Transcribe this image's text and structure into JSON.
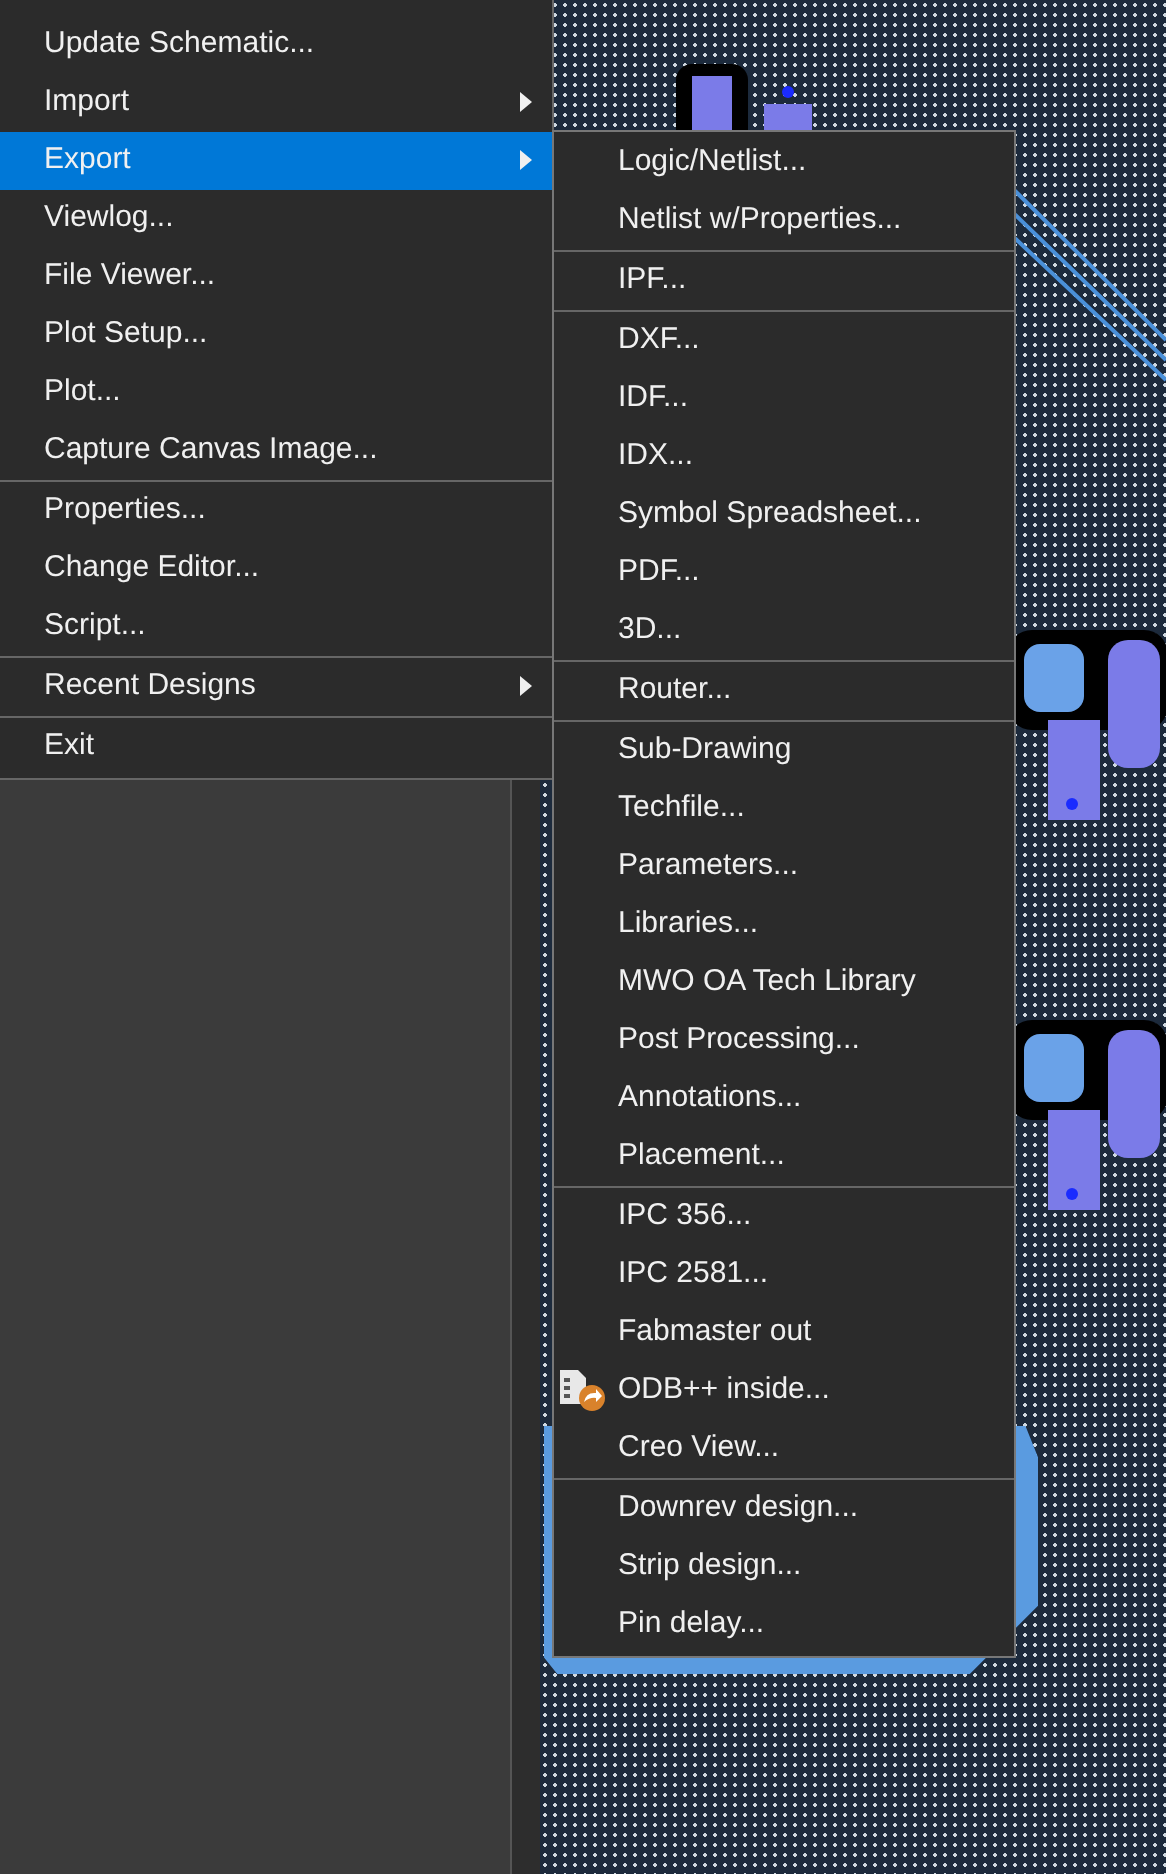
{
  "menu": {
    "items": [
      {
        "kind": "item",
        "label": "Update Schematic...",
        "has_submenu": false,
        "selected": false
      },
      {
        "kind": "item",
        "label": "Import",
        "has_submenu": true,
        "selected": false
      },
      {
        "kind": "item",
        "label": "Export",
        "has_submenu": true,
        "selected": true
      },
      {
        "kind": "item",
        "label": "Viewlog...",
        "has_submenu": false,
        "selected": false
      },
      {
        "kind": "item",
        "label": "File Viewer...",
        "has_submenu": false,
        "selected": false
      },
      {
        "kind": "item",
        "label": "Plot Setup...",
        "has_submenu": false,
        "selected": false
      },
      {
        "kind": "item",
        "label": "Plot...",
        "has_submenu": false,
        "selected": false
      },
      {
        "kind": "item",
        "label": "Capture Canvas Image...",
        "has_submenu": false,
        "selected": false
      },
      {
        "kind": "separator"
      },
      {
        "kind": "item",
        "label": "Properties...",
        "has_submenu": false,
        "selected": false
      },
      {
        "kind": "item",
        "label": "Change Editor...",
        "has_submenu": false,
        "selected": false
      },
      {
        "kind": "item",
        "label": "Script...",
        "has_submenu": false,
        "selected": false
      },
      {
        "kind": "separator"
      },
      {
        "kind": "item",
        "label": "Recent Designs",
        "has_submenu": true,
        "selected": false
      },
      {
        "kind": "separator"
      },
      {
        "kind": "item",
        "label": "Exit",
        "has_submenu": false,
        "selected": false
      }
    ]
  },
  "submenu": {
    "items": [
      {
        "kind": "item",
        "label": "Logic/Netlist..."
      },
      {
        "kind": "item",
        "label": "Netlist w/Properties..."
      },
      {
        "kind": "separator"
      },
      {
        "kind": "item",
        "label": "IPF..."
      },
      {
        "kind": "separator"
      },
      {
        "kind": "item",
        "label": "DXF..."
      },
      {
        "kind": "item",
        "label": "IDF..."
      },
      {
        "kind": "item",
        "label": "IDX..."
      },
      {
        "kind": "item",
        "label": "Symbol Spreadsheet..."
      },
      {
        "kind": "item",
        "label": "PDF..."
      },
      {
        "kind": "item",
        "label": "3D..."
      },
      {
        "kind": "separator"
      },
      {
        "kind": "item",
        "label": "Router..."
      },
      {
        "kind": "separator"
      },
      {
        "kind": "item",
        "label": "Sub-Drawing"
      },
      {
        "kind": "item",
        "label": "Techfile..."
      },
      {
        "kind": "item",
        "label": "Parameters..."
      },
      {
        "kind": "item",
        "label": "Libraries..."
      },
      {
        "kind": "item",
        "label": "MWO OA Tech Library"
      },
      {
        "kind": "item",
        "label": "Post Processing..."
      },
      {
        "kind": "item",
        "label": "Annotations..."
      },
      {
        "kind": "item",
        "label": "Placement..."
      },
      {
        "kind": "separator"
      },
      {
        "kind": "item",
        "label": "IPC 356..."
      },
      {
        "kind": "item",
        "label": "IPC 2581..."
      },
      {
        "kind": "item",
        "label": "Fabmaster out"
      },
      {
        "kind": "icon_item",
        "label": "ODB++ inside..."
      },
      {
        "kind": "item",
        "label": "Creo View..."
      },
      {
        "kind": "separator"
      },
      {
        "kind": "item",
        "label": "Downrev design..."
      },
      {
        "kind": "item",
        "label": "Strip design..."
      },
      {
        "kind": "item",
        "label": "Pin delay..."
      }
    ]
  }
}
